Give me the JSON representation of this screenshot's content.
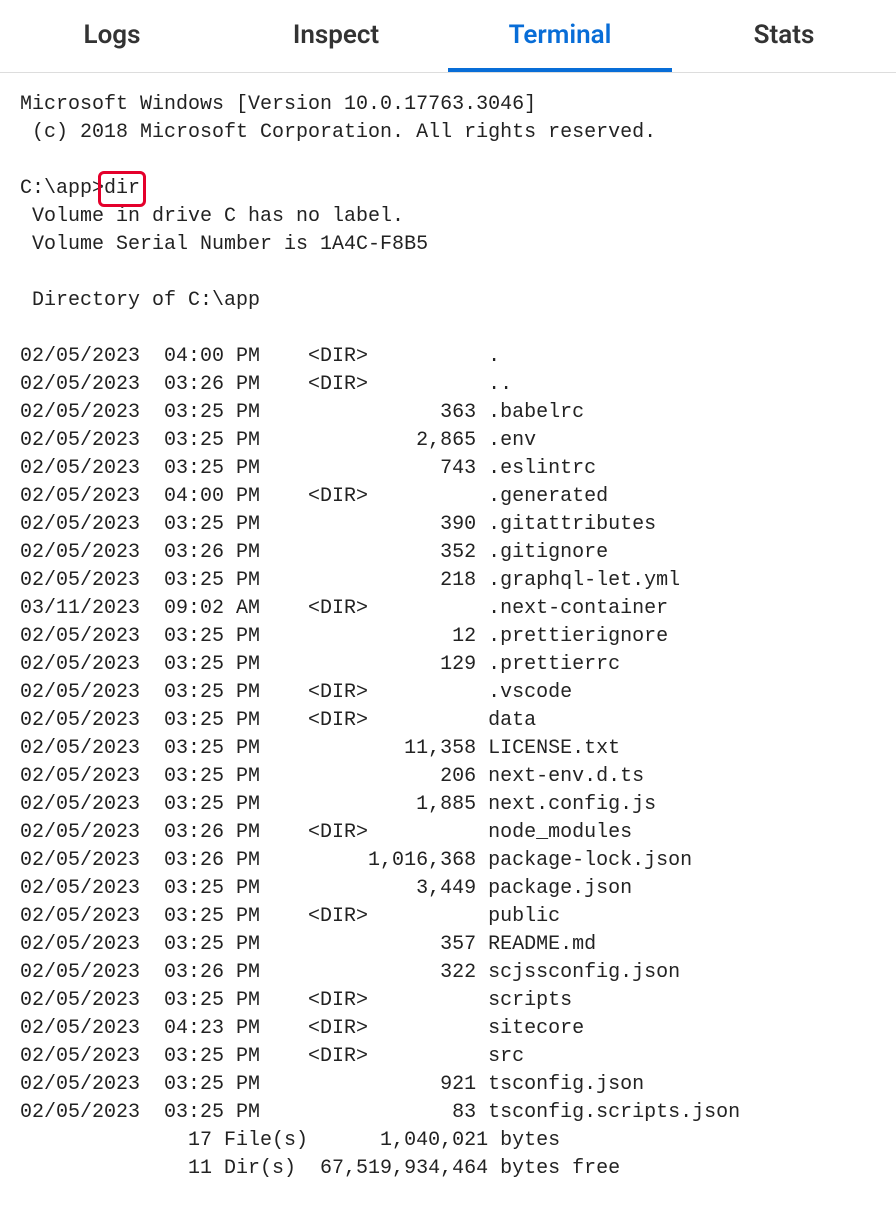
{
  "tabs": {
    "logs": "Logs",
    "inspect": "Inspect",
    "terminal": "Terminal",
    "stats": "Stats"
  },
  "banner": {
    "line1": "Microsoft Windows [Version 10.0.17763.3046]",
    "line2": " (c) 2018 Microsoft Corporation. All rights reserved."
  },
  "prompt": {
    "path": "C:\\app>",
    "command": "dir"
  },
  "dir_header": {
    "vol": " Volume in drive C has no label.",
    "serial": " Volume Serial Number is 1A4C-F8B5",
    "of": " Directory of C:\\app"
  },
  "entries": [
    {
      "date": "02/05/2023",
      "time": "04:00 PM",
      "dir": true,
      "size": "",
      "name": "."
    },
    {
      "date": "02/05/2023",
      "time": "03:26 PM",
      "dir": true,
      "size": "",
      "name": ".."
    },
    {
      "date": "02/05/2023",
      "time": "03:25 PM",
      "dir": false,
      "size": "363",
      "name": ".babelrc"
    },
    {
      "date": "02/05/2023",
      "time": "03:25 PM",
      "dir": false,
      "size": "2,865",
      "name": ".env"
    },
    {
      "date": "02/05/2023",
      "time": "03:25 PM",
      "dir": false,
      "size": "743",
      "name": ".eslintrc"
    },
    {
      "date": "02/05/2023",
      "time": "04:00 PM",
      "dir": true,
      "size": "",
      "name": ".generated"
    },
    {
      "date": "02/05/2023",
      "time": "03:25 PM",
      "dir": false,
      "size": "390",
      "name": ".gitattributes"
    },
    {
      "date": "02/05/2023",
      "time": "03:26 PM",
      "dir": false,
      "size": "352",
      "name": ".gitignore"
    },
    {
      "date": "02/05/2023",
      "time": "03:25 PM",
      "dir": false,
      "size": "218",
      "name": ".graphql-let.yml"
    },
    {
      "date": "03/11/2023",
      "time": "09:02 AM",
      "dir": true,
      "size": "",
      "name": ".next-container"
    },
    {
      "date": "02/05/2023",
      "time": "03:25 PM",
      "dir": false,
      "size": "12",
      "name": ".prettierignore"
    },
    {
      "date": "02/05/2023",
      "time": "03:25 PM",
      "dir": false,
      "size": "129",
      "name": ".prettierrc"
    },
    {
      "date": "02/05/2023",
      "time": "03:25 PM",
      "dir": true,
      "size": "",
      "name": ".vscode"
    },
    {
      "date": "02/05/2023",
      "time": "03:25 PM",
      "dir": true,
      "size": "",
      "name": "data"
    },
    {
      "date": "02/05/2023",
      "time": "03:25 PM",
      "dir": false,
      "size": "11,358",
      "name": "LICENSE.txt"
    },
    {
      "date": "02/05/2023",
      "time": "03:25 PM",
      "dir": false,
      "size": "206",
      "name": "next-env.d.ts"
    },
    {
      "date": "02/05/2023",
      "time": "03:25 PM",
      "dir": false,
      "size": "1,885",
      "name": "next.config.js"
    },
    {
      "date": "02/05/2023",
      "time": "03:26 PM",
      "dir": true,
      "size": "",
      "name": "node_modules"
    },
    {
      "date": "02/05/2023",
      "time": "03:26 PM",
      "dir": false,
      "size": "1,016,368",
      "name": "package-lock.json"
    },
    {
      "date": "02/05/2023",
      "time": "03:25 PM",
      "dir": false,
      "size": "3,449",
      "name": "package.json"
    },
    {
      "date": "02/05/2023",
      "time": "03:25 PM",
      "dir": true,
      "size": "",
      "name": "public"
    },
    {
      "date": "02/05/2023",
      "time": "03:25 PM",
      "dir": false,
      "size": "357",
      "name": "README.md"
    },
    {
      "date": "02/05/2023",
      "time": "03:26 PM",
      "dir": false,
      "size": "322",
      "name": "scjssconfig.json"
    },
    {
      "date": "02/05/2023",
      "time": "03:25 PM",
      "dir": true,
      "size": "",
      "name": "scripts"
    },
    {
      "date": "02/05/2023",
      "time": "04:23 PM",
      "dir": true,
      "size": "",
      "name": "sitecore"
    },
    {
      "date": "02/05/2023",
      "time": "03:25 PM",
      "dir": true,
      "size": "",
      "name": "src"
    },
    {
      "date": "02/05/2023",
      "time": "03:25 PM",
      "dir": false,
      "size": "921",
      "name": "tsconfig.json"
    },
    {
      "date": "02/05/2023",
      "time": "03:25 PM",
      "dir": false,
      "size": "83",
      "name": "tsconfig.scripts.json"
    }
  ],
  "summary": {
    "files": "              17 File(s)      1,040,021 bytes",
    "dirs": "              11 Dir(s)  67,519,934,464 bytes free"
  }
}
